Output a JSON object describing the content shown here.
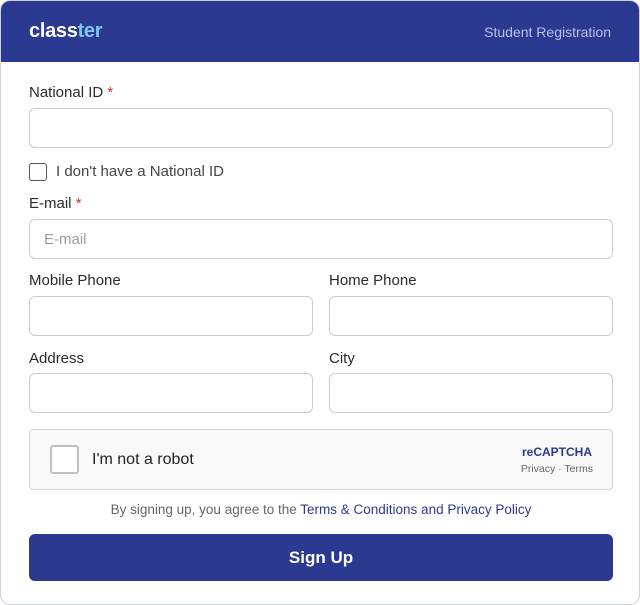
{
  "header": {
    "logo_part1": "class",
    "logo_part2": "ter",
    "title": "Student Registration"
  },
  "form": {
    "national_id": {
      "label": "National ID",
      "required_mark": "*",
      "value": ""
    },
    "no_national_id": {
      "label": "I don't have a National ID",
      "checked": false
    },
    "email": {
      "label": "E-mail",
      "required_mark": "*",
      "placeholder": "E-mail",
      "value": ""
    },
    "mobile_phone": {
      "label": "Mobile Phone",
      "value": ""
    },
    "home_phone": {
      "label": "Home Phone",
      "value": ""
    },
    "address": {
      "label": "Address",
      "value": ""
    },
    "city": {
      "label": "City",
      "value": ""
    }
  },
  "captcha": {
    "label": "I'm not a robot",
    "brand": "reCAPTCHA",
    "privacy": "Privacy",
    "separator": " · ",
    "terms": "Terms"
  },
  "agreement": {
    "prefix": "By signing up, you agree to the ",
    "link": "Terms & Conditions and Privacy Policy"
  },
  "signup_button": "Sign Up",
  "colors": {
    "brand": "#2c3990",
    "logo_accent": "#7ec8f0",
    "required": "#d32f2f"
  }
}
